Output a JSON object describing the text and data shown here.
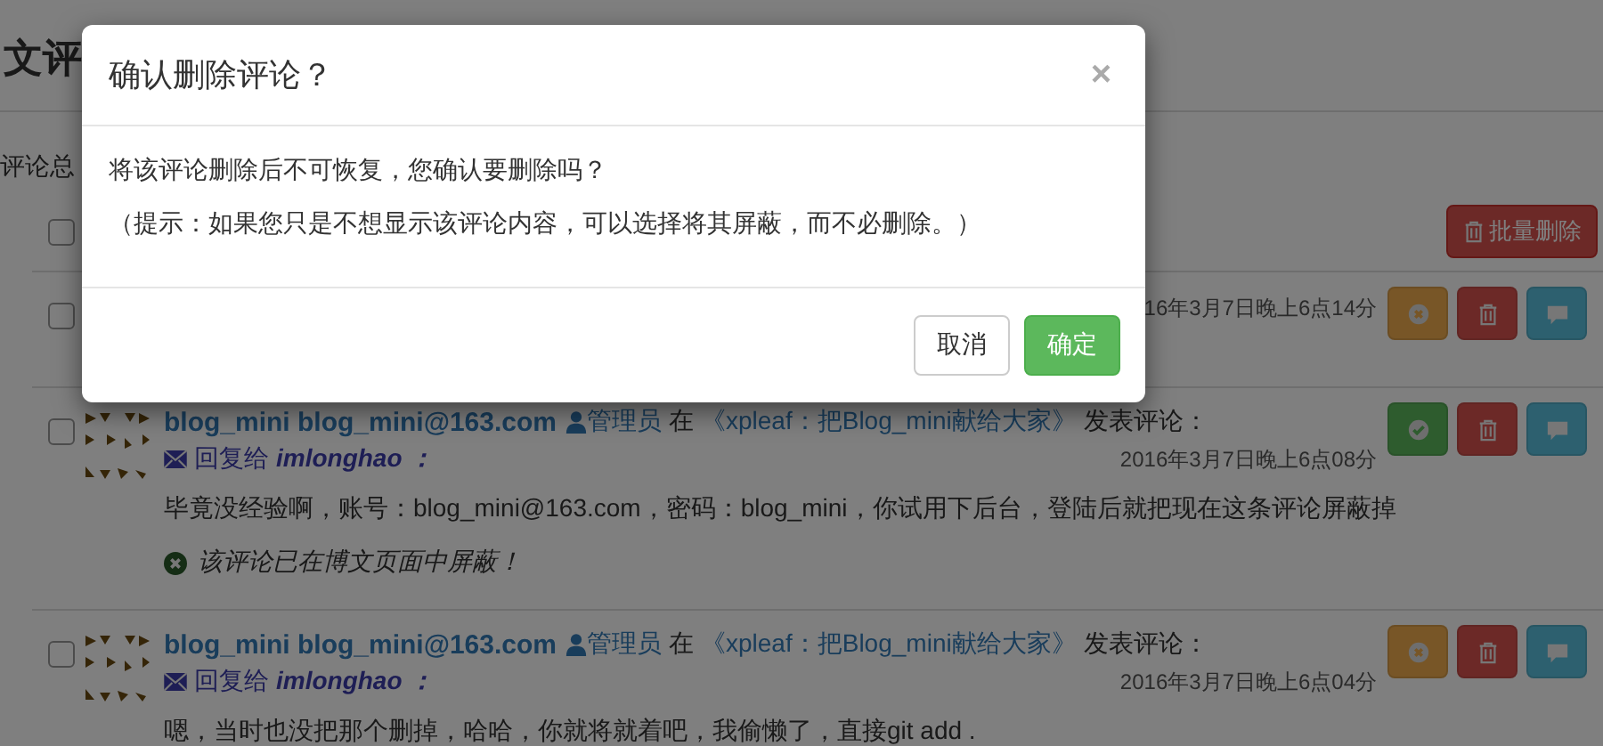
{
  "page": {
    "title": "文评",
    "total_label": "评论总",
    "batch_delete": "批量删除",
    "select_all_checked": false,
    "comments": [
      {
        "date": "16年3月7日晚上6点14分",
        "shielded": false,
        "checked": false
      },
      {
        "author": "blog_mini blog_mini@163.com",
        "role": "管理员",
        "in": "在",
        "article": "《xpleaf：把Blog_mini献给大家》",
        "action": "发表评论：",
        "reply_label": "回复给",
        "reply_to": "imlonghao ：",
        "date": "2016年3月7日晚上6点08分",
        "checked": false,
        "content": "毕竟没经验啊，账号：blog_mini@163.com，密码：blog_mini，你试用下后台，登陆后就把现在这条评论屏蔽掉",
        "shielded": true,
        "note": "该评论已在博文页面中屏蔽！"
      },
      {
        "author": "blog_mini blog_mini@163.com",
        "role": "管理员",
        "in": "在",
        "article": "《xpleaf：把Blog_mini献给大家》",
        "action": "发表评论：",
        "reply_label": "回复给",
        "reply_to": "imlonghao ：",
        "date": "2016年3月7日晚上6点04分",
        "checked": false,
        "content": "嗯，当时也没把那个删掉，哈哈，你就将就着吧，我偷懒了，直接git add .",
        "shielded": false
      }
    ]
  },
  "modal": {
    "title": "确认删除评论？",
    "close": "×",
    "message": "将该评论删除后不可恢复，您确认要删除吗？",
    "hint": "（提示：如果您只是不想显示该评论内容，可以选择将其屏蔽，而不必删除。）",
    "buttons": [
      {
        "label": "取消",
        "kind": "default"
      },
      {
        "label": "确定",
        "kind": "success"
      }
    ]
  }
}
